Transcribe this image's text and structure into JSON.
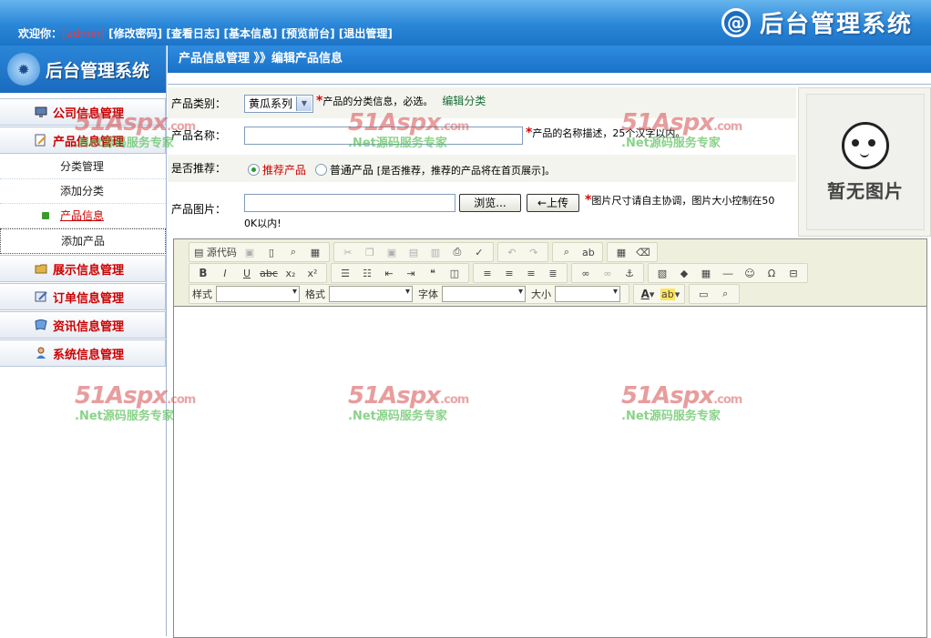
{
  "header": {
    "welcome": "欢迎你：",
    "user": "[admin]",
    "links": [
      "[修改密码]",
      "[查看日志]",
      "[基本信息]",
      "[预览前台]",
      "[退出管理]"
    ],
    "logo_mark": "@",
    "logo_text": "后台管理系统"
  },
  "sidebar": {
    "logo_text": "后台管理系统",
    "menu": [
      {
        "label": "公司信息管理",
        "icon": "monitor-icon"
      },
      {
        "label": "产品信息管理",
        "icon": "document-pen-icon"
      },
      {
        "label": "展示信息管理",
        "icon": "folder-icon"
      },
      {
        "label": "订单信息管理",
        "icon": "notepad-icon"
      },
      {
        "label": "资讯信息管理",
        "icon": "news-icon"
      },
      {
        "label": "系统信息管理",
        "icon": "user-icon"
      }
    ],
    "submenu": [
      "分类管理",
      "添加分类",
      "产品信息",
      "添加产品"
    ]
  },
  "breadcrumb": "产品信息管理 》》编辑产品信息",
  "form": {
    "category_label": "产品类别：",
    "category_value": "黄瓜系列",
    "category_hint": "产品的分类信息，必选。",
    "edit_category": "编辑分类",
    "name_label": "产品名称：",
    "name_value": "",
    "name_hint": "产品的名称描述，25个汉字以内。",
    "recommend_label": "是否推荐：",
    "recommend_yes": "推荐产品",
    "recommend_no": "普通产品",
    "recommend_hint": "[是否推荐，推荐的产品将在首页展示]。",
    "image_label": "产品图片：",
    "image_value": "",
    "browse_button": "浏览...",
    "upload_button": "←上传",
    "image_hint": "图片尺寸请自主协调，图片大小控制在50",
    "image_hint2": "0K以内!"
  },
  "preview": {
    "text": "暂无图片"
  },
  "editor": {
    "source_label": "源代码",
    "style_label": "样式",
    "format_label": "格式",
    "font_label": "字体",
    "size_label": "大小"
  },
  "watermark": {
    "brand": "51Aspx",
    "domain": ".com",
    "slogan": ".Net源码服务专家"
  }
}
